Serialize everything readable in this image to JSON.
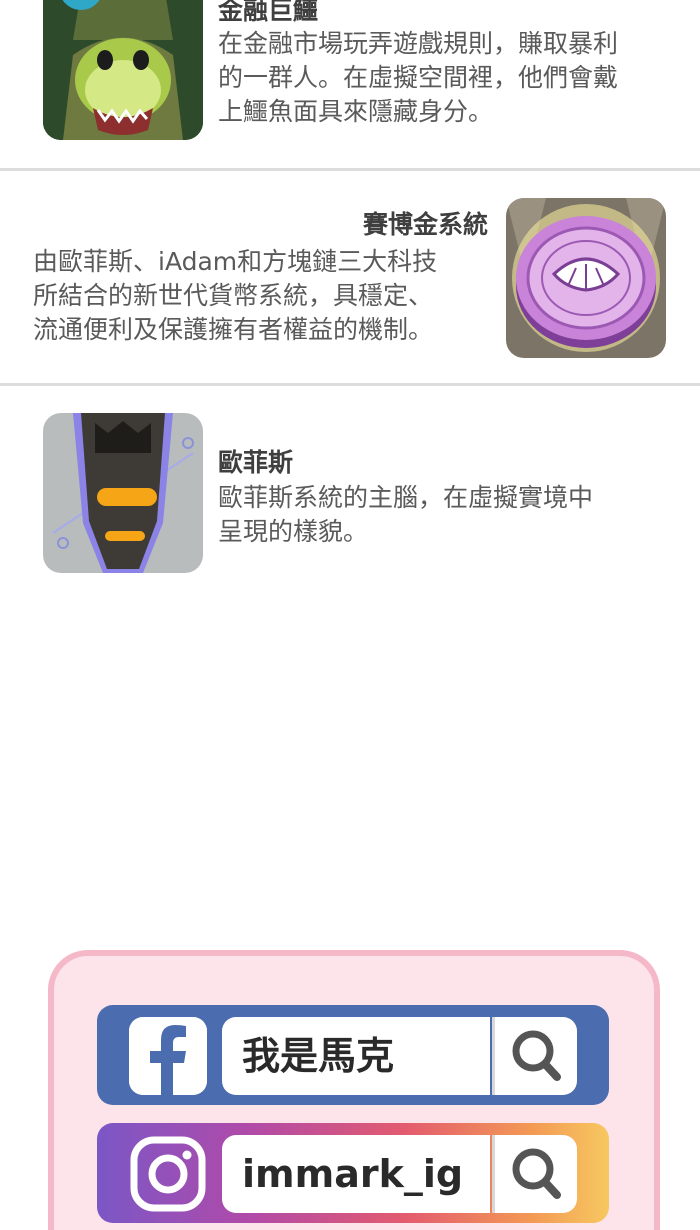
{
  "entries": [
    {
      "name": "金融巨鱷",
      "description": [
        "在金融市場玩弄遊戲規則，賺取暴利",
        "的一群人。在虛擬空間裡，他們會戴",
        "上鱷魚面具來隱藏身分。"
      ]
    },
    {
      "name": "賽博金系統",
      "description": [
        "由歐菲斯、iAdam和方塊鏈三大科技",
        "所結合的新世代貨幣系統，具穩定、",
        "流通便利及保護擁有者權益的機制。"
      ]
    },
    {
      "name": "歐菲斯",
      "description": [
        "歐菲斯系統的主腦，在虛擬實境中",
        "呈現的樣貌。"
      ]
    }
  ],
  "social": {
    "facebook": {
      "query": "我是馬克",
      "color": "#4b6cae"
    },
    "instagram": {
      "query": "immark_ig"
    }
  },
  "colors": {
    "card_bg": "#fde3ea",
    "card_border": "#f5b8c8",
    "divider": "#dcdcdc"
  }
}
